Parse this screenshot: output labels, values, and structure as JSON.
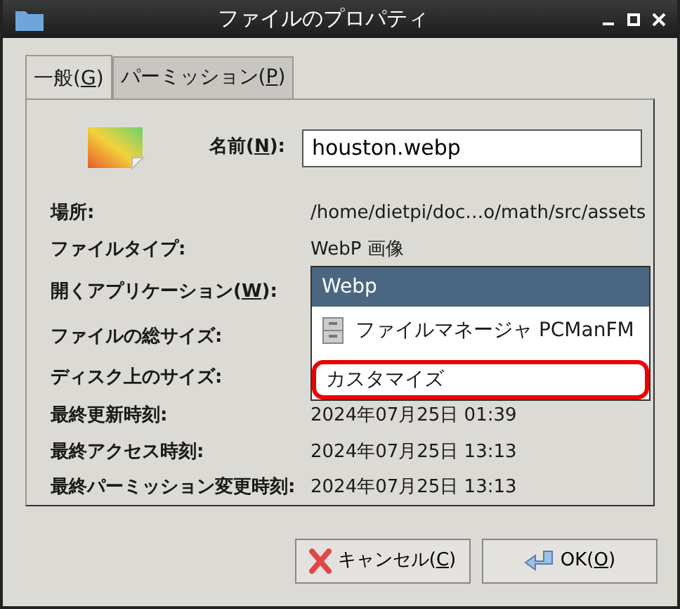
{
  "window": {
    "title": "ファイルのプロパティ"
  },
  "tabs": [
    {
      "before": "一般(",
      "mnemonic": "G",
      "after": ")",
      "selected": true
    },
    {
      "before": "パーミッション(",
      "mnemonic": "P",
      "after": ")",
      "selected": false
    }
  ],
  "name_field": {
    "before": "名前(",
    "mnemonic": "N",
    "after": "):",
    "value": "houston.webp"
  },
  "rows": [
    {
      "label": "場所:",
      "value": "/home/dietpi/doc…o/math/src/assets"
    },
    {
      "label": "ファイルタイプ:",
      "value": "WebP 画像"
    },
    {
      "label_before": "開くアプリケーション(",
      "mnemonic": "W",
      "label_after": "):",
      "kind": "dropdown"
    },
    {
      "label": "ファイルの総サイズ:"
    },
    {
      "label": "ディスク上のサイズ:"
    },
    {
      "label": "最終更新時刻:",
      "value": "2024年07月25日 01:39"
    },
    {
      "label": "最終アクセス時刻:",
      "value": "2024年07月25日 13:13"
    },
    {
      "label": "最終パーミッション変更時刻:",
      "value": "2024年07月25日 13:13"
    }
  ],
  "dropdown_items": [
    {
      "label": "Webp",
      "selected": true,
      "highlighted": false,
      "kind": "plain"
    },
    {
      "label": "ファイルマネージャ PCManFM",
      "selected": false,
      "highlighted": false,
      "kind": "app"
    },
    {
      "label": "カスタマイズ",
      "selected": false,
      "highlighted": true,
      "kind": "plain"
    }
  ],
  "buttons": [
    {
      "before": "キャンセル(",
      "mnemonic": "C",
      "after": ")",
      "kind": "cancel"
    },
    {
      "before": "OK(",
      "mnemonic": "O",
      "after": ")",
      "kind": "ok"
    }
  ]
}
